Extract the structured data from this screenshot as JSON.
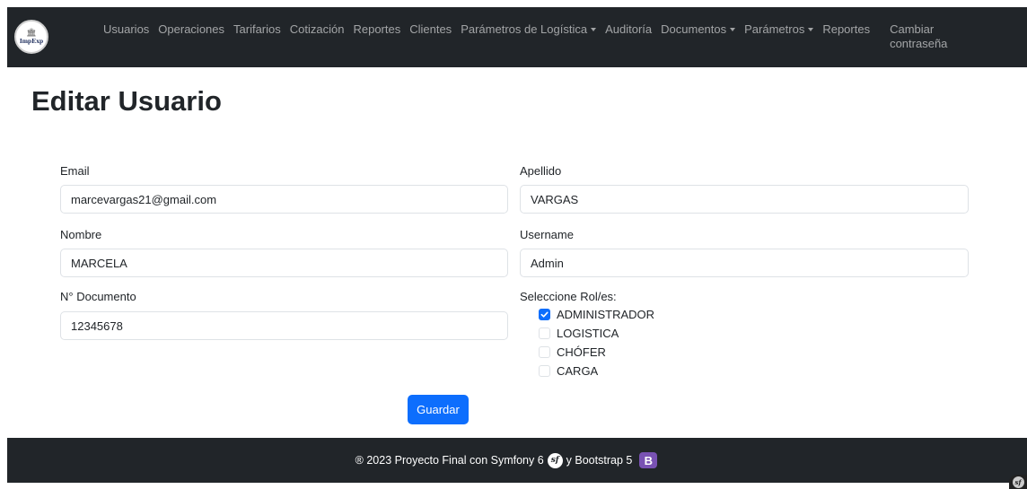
{
  "navbar": {
    "brand": {
      "logo_text": "ImpExp"
    },
    "items": [
      {
        "label": "Usuarios",
        "dropdown": false
      },
      {
        "label": "Operaciones",
        "dropdown": false
      },
      {
        "label": "Tarifarios",
        "dropdown": false
      },
      {
        "label": "Cotización",
        "dropdown": false
      },
      {
        "label": "Reportes",
        "dropdown": false
      },
      {
        "label": "Clientes",
        "dropdown": false
      },
      {
        "label": "Parámetros de Logística",
        "dropdown": true
      },
      {
        "label": "Auditoría",
        "dropdown": false
      },
      {
        "label": "Documentos",
        "dropdown": true
      },
      {
        "label": "Parámetros",
        "dropdown": true
      },
      {
        "label": "Reportes",
        "dropdown": false
      }
    ],
    "change_password": "Cambiar contraseña"
  },
  "page": {
    "title": "Editar Usuario"
  },
  "form": {
    "email": {
      "label": "Email",
      "value": "marcevargas21@gmail.com"
    },
    "apellido": {
      "label": "Apellido",
      "value": "VARGAS"
    },
    "nombre": {
      "label": "Nombre",
      "value": "MARCELA"
    },
    "username": {
      "label": "Username",
      "value": "Admin"
    },
    "documento": {
      "label": "N° Documento",
      "value": "12345678"
    },
    "roles": {
      "label": "Seleccione Rol/es:",
      "options": [
        {
          "label": "ADMINISTRADOR",
          "checked": true
        },
        {
          "label": "LOGISTICA",
          "checked": false
        },
        {
          "label": "CHÓFER",
          "checked": false
        },
        {
          "label": "CARGA",
          "checked": false
        }
      ]
    },
    "save_label": "Guardar"
  },
  "footer": {
    "text_before": "® 2023 Proyecto Final con Symfony 6",
    "text_middle": "y Bootstrap 5",
    "symfony_icon_text": "sf",
    "bootstrap_icon_text": "B"
  },
  "colors": {
    "navbar_bg": "#212529",
    "primary": "#0d6efd",
    "bootstrap_purple": "#7952b3"
  },
  "icons": [
    "building-logo-icon",
    "caret-down-icon",
    "check-icon",
    "symfony-icon",
    "bootstrap-icon",
    "symfony-toolbar-icon"
  ]
}
